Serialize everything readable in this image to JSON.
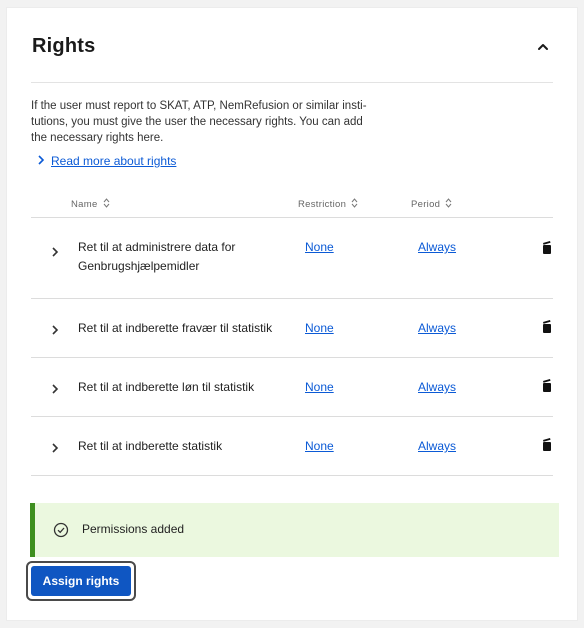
{
  "section": {
    "title": "Rights",
    "description": "If the user must report to SKAT, ATP, NemRefusion or similar insti-tutions, you must give the user the necessary rights. You can add the necessary rights here.",
    "description_lines": [
      "If the user must report to SKAT, ATP, NemRefusion or similar insti-",
      "tutions, you must give the user the necessary rights. You can add",
      "the necessary rights here."
    ],
    "read_more": "Read more about rights"
  },
  "table": {
    "headers": {
      "name": "Name",
      "restriction": "Restriction",
      "period": "Period"
    },
    "rows": [
      {
        "name": "Ret til at administrere data for Genbrugshjælpemidler",
        "restriction": "None",
        "period": "Always"
      },
      {
        "name": "Ret til at indberette fravær til statistik",
        "restriction": "None",
        "period": "Always"
      },
      {
        "name": "Ret til at indberette løn til statistik",
        "restriction": "None",
        "period": "Always"
      },
      {
        "name": "Ret til at indberette statistik",
        "restriction": "None",
        "period": "Always"
      }
    ]
  },
  "notice": {
    "message": "Permissions added",
    "status_color": "#3e8f1f"
  },
  "actions": {
    "assign_label": "Assign rights",
    "accent": "#0f56c2"
  },
  "icons": {
    "collapse": "chevron-up-icon",
    "expand": "chevron-right-icon",
    "sort": "sort-icon",
    "delete": "trash-icon",
    "success": "check-circle-icon"
  }
}
